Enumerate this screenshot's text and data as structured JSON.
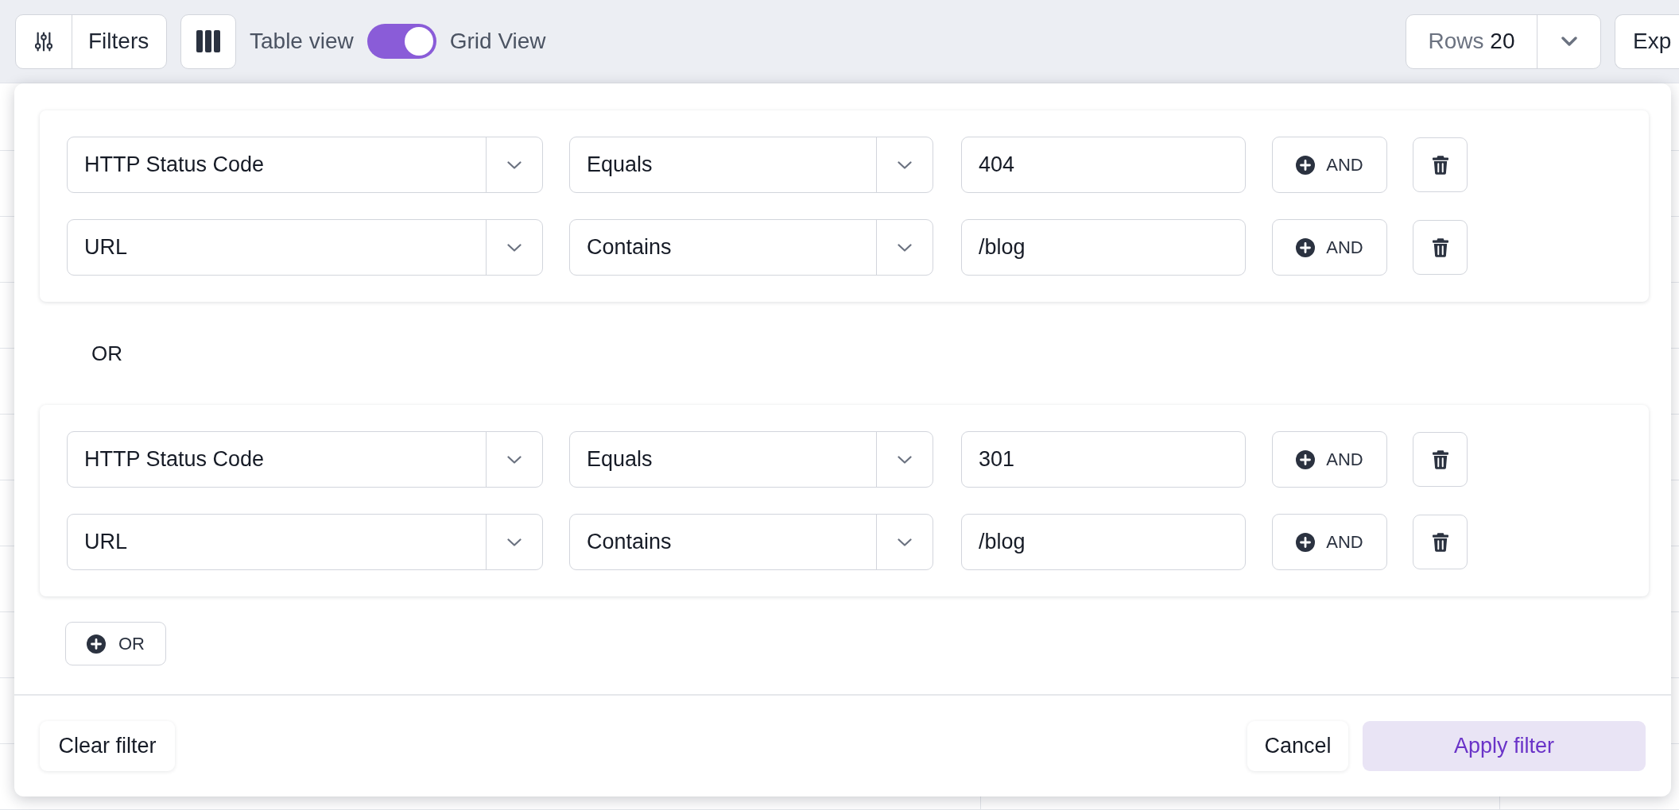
{
  "toolbar": {
    "filters_button": {
      "label": "Filters"
    },
    "view_toggle": {
      "left_label": "Table view",
      "on": true,
      "right_label": "Grid View"
    },
    "rows_button": {
      "label": "Rows",
      "value": "20"
    },
    "export_button": {
      "label": "Exp"
    }
  },
  "filter_panel": {
    "groups": [
      {
        "conditions": [
          {
            "field": "HTTP Status Code",
            "operator": "Equals",
            "value": "404",
            "add_label": "AND"
          },
          {
            "field": "URL",
            "operator": "Contains",
            "value": "/blog",
            "add_label": "AND"
          }
        ]
      },
      {
        "connector": "OR",
        "conditions": [
          {
            "field": "HTTP Status Code",
            "operator": "Equals",
            "value": "301",
            "add_label": "AND"
          },
          {
            "field": "URL",
            "operator": "Contains",
            "value": "/blog",
            "add_label": "AND"
          }
        ]
      }
    ],
    "add_group_button": {
      "label": "OR"
    },
    "footer": {
      "clear_button": {
        "label": "Clear filter"
      },
      "cancel_button": {
        "label": "Cancel"
      },
      "apply_button": {
        "label": "Apply filter"
      }
    }
  }
}
